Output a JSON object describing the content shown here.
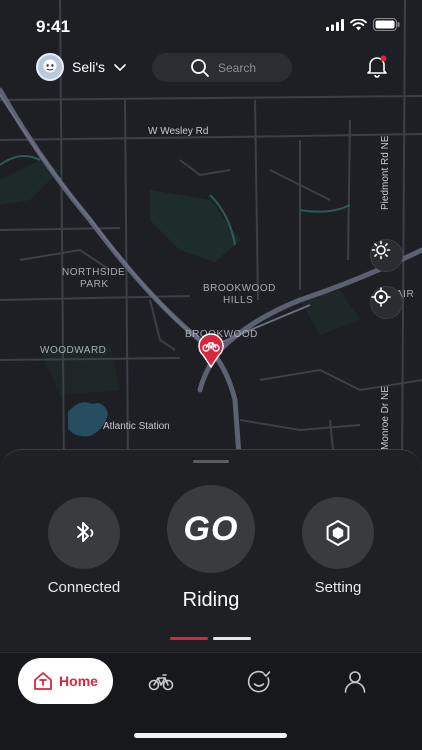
{
  "status_bar": {
    "time": "9:41"
  },
  "header": {
    "user_name": "Seli's",
    "search_placeholder": "Search"
  },
  "map": {
    "labels": {
      "wesley": "W Wesley Rd",
      "piedmont": "Piedmont Rd NE",
      "northside": "NORTHSIDE",
      "park": "PARK",
      "brookwood_hills_1": "BROOKWOOD",
      "brookwood_hills_2": "HILLS",
      "brookwood": "BROOKWOOD",
      "woodward": "WOODWARD",
      "atlantic": "Atlantic Station",
      "air": "AIR",
      "monroe": "Monroe Dr NE"
    }
  },
  "sheet": {
    "connected_label": "Connected",
    "go_label": "GO",
    "riding_label": "Riding",
    "setting_label": "Setting"
  },
  "tabbar": {
    "home_label": "Home"
  },
  "colors": {
    "accent": "#d9263a",
    "background": "#17181b",
    "sheet": "#1f2023",
    "map": "#1d1f25"
  }
}
